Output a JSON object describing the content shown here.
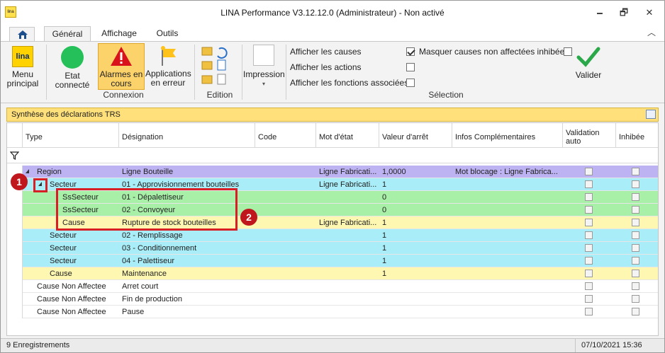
{
  "window": {
    "title": "LINA Performance  V3.12.12.0  (Administrateur) - Non activé",
    "app_icon_text": "lina",
    "minimize": "🗕",
    "restore": "🗗",
    "close": "✕"
  },
  "tabs": [
    {
      "label": "Général",
      "active": true
    },
    {
      "label": "Affichage",
      "active": false
    },
    {
      "label": "Outils",
      "active": false
    }
  ],
  "ribbon": {
    "menu_principal": "Menu\nprincipal",
    "menu_logo": "lina",
    "etat_connecte": "Etat\nconnecté",
    "alarmes_en_cours": "Alarmes en\ncours",
    "applications_en_erreur": "Applications\nen erreur",
    "group_connexion": "Connexion",
    "group_edition": "Edition",
    "impression": "Impression",
    "group_selection": "Sélection",
    "valider": "Valider",
    "options": [
      {
        "label": "Afficher les causes",
        "checked": true
      },
      {
        "label": "Afficher les actions",
        "checked": false
      },
      {
        "label": "Afficher les fonctions associées",
        "checked": false
      }
    ],
    "masquer": {
      "label": "Masquer causes non affectées inhibées",
      "checked": false
    },
    "colors": {
      "etat_connecte": "#26c05a",
      "alarmes": "#d9111b",
      "valider": "#2aa84a"
    }
  },
  "panel": {
    "title": "Synthèse des déclarations TRS"
  },
  "grid": {
    "columns": [
      "Type",
      "Désignation",
      "Code",
      "Mot d'état",
      "Valeur d'arrêt",
      "Infos Complémentaires",
      "Validation\nauto",
      "Inhibée"
    ],
    "rows": [
      {
        "type": "Region",
        "indent": 0,
        "designation": "Ligne Bouteille",
        "code": "",
        "mot_etat": "Ligne Fabricati...",
        "valeur": "1,0000",
        "infos": "Mot blocage : Ligne Fabrica...",
        "color": "#bdb3f2"
      },
      {
        "type": "Secteur",
        "indent": 1,
        "designation": "01 - Approvisionnement bouteilles",
        "code": "",
        "mot_etat": "Ligne Fabricati...",
        "valeur": "1",
        "infos": "",
        "color": "#a8edf7"
      },
      {
        "type": "SsSecteur",
        "indent": 2,
        "designation": "01 - Dépalettiseur",
        "code": "",
        "mot_etat": "",
        "valeur": "0",
        "infos": "",
        "color": "#a8f0a8"
      },
      {
        "type": "SsSecteur",
        "indent": 2,
        "designation": "02 - Convoyeur",
        "code": "",
        "mot_etat": "",
        "valeur": "0",
        "infos": "",
        "color": "#a8f0a8"
      },
      {
        "type": "Cause",
        "indent": 2,
        "designation": "Rupture de stock bouteilles",
        "code": "",
        "mot_etat": "Ligne Fabricati...",
        "valeur": "1",
        "infos": "",
        "color": "#fdf7b2"
      },
      {
        "type": "Secteur",
        "indent": 1,
        "designation": "02 - Remplissage",
        "code": "",
        "mot_etat": "",
        "valeur": "1",
        "infos": "",
        "color": "#a8edf7"
      },
      {
        "type": "Secteur",
        "indent": 1,
        "designation": "03 - Conditionnement",
        "code": "",
        "mot_etat": "",
        "valeur": "1",
        "infos": "",
        "color": "#a8edf7"
      },
      {
        "type": "Secteur",
        "indent": 1,
        "designation": "04 - Palettiseur",
        "code": "",
        "mot_etat": "",
        "valeur": "1",
        "infos": "",
        "color": "#a8edf7"
      },
      {
        "type": "Cause",
        "indent": 1,
        "designation": "Maintenance",
        "code": "",
        "mot_etat": "",
        "valeur": "1",
        "infos": "",
        "color": "#fdf7b2"
      },
      {
        "type": "Cause Non Affectee",
        "indent": 0,
        "designation": "Arret court",
        "code": "",
        "mot_etat": "",
        "valeur": "",
        "infos": "",
        "color": "#ffffff"
      },
      {
        "type": "Cause Non Affectee",
        "indent": 0,
        "designation": "Fin de production",
        "code": "",
        "mot_etat": "",
        "valeur": "",
        "infos": "",
        "color": "#ffffff"
      },
      {
        "type": "Cause Non Affectee",
        "indent": 0,
        "designation": "Pause",
        "code": "",
        "mot_etat": "",
        "valeur": "",
        "infos": "",
        "color": "#ffffff"
      }
    ]
  },
  "callouts": [
    "1",
    "2"
  ],
  "status": {
    "count": "9 Enregistrements",
    "datetime": "07/10/2021 15:36"
  }
}
